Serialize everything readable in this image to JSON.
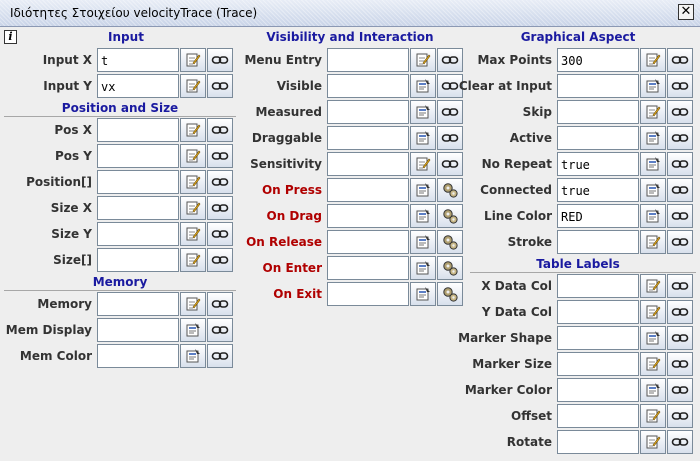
{
  "window": {
    "title": "Ιδιότητες Στοιχείου velocityTrace (Trace)",
    "close_label": "✕",
    "info_label": "i"
  },
  "sections": {
    "input": "Input",
    "position_size": "Position and Size",
    "memory": "Memory",
    "visibility": "Visibility and Interaction",
    "graphical": "Graphical Aspect",
    "table_labels": "Table Labels"
  },
  "col1": {
    "input": [
      {
        "label": "Input X",
        "value": "t",
        "b1": "edit-icon",
        "b2": "link-icon"
      },
      {
        "label": "Input Y",
        "value": "vx",
        "b1": "edit-icon",
        "b2": "link-icon"
      }
    ],
    "position": [
      {
        "label": "Pos X",
        "value": "",
        "b1": "edit-icon",
        "b2": "link-icon"
      },
      {
        "label": "Pos Y",
        "value": "",
        "b1": "edit-icon",
        "b2": "link-icon"
      },
      {
        "label": "Position[]",
        "value": "",
        "b1": "edit-icon",
        "b2": "link-icon"
      },
      {
        "label": "Size X",
        "value": "",
        "b1": "edit-icon",
        "b2": "link-icon"
      },
      {
        "label": "Size Y",
        "value": "",
        "b1": "edit-icon",
        "b2": "link-icon"
      },
      {
        "label": "Size[]",
        "value": "",
        "b1": "edit-icon",
        "b2": "link-icon"
      }
    ],
    "memory": [
      {
        "label": "Memory",
        "value": "",
        "b1": "edit-icon",
        "b2": "link-icon"
      },
      {
        "label": "Mem Display",
        "value": "",
        "b1": "options-icon",
        "b2": "link-icon"
      },
      {
        "label": "Mem Color",
        "value": "",
        "b1": "options-icon",
        "b2": "link-icon"
      }
    ]
  },
  "col2": [
    {
      "label": "Menu Entry",
      "value": "",
      "b1": "edit-icon",
      "b2": "link-icon",
      "red": false
    },
    {
      "label": "Visible",
      "value": "",
      "b1": "options-icon",
      "b2": "link-icon",
      "red": false
    },
    {
      "label": "Measured",
      "value": "",
      "b1": "options-icon",
      "b2": "link-icon",
      "red": false
    },
    {
      "label": "Draggable",
      "value": "",
      "b1": "options-icon",
      "b2": "link-icon",
      "red": false
    },
    {
      "label": "Sensitivity",
      "value": "",
      "b1": "edit-icon",
      "b2": "link-icon",
      "red": false
    },
    {
      "label": "On Press",
      "value": "",
      "b1": "options-icon",
      "b2": "gears-icon",
      "red": true
    },
    {
      "label": "On Drag",
      "value": "",
      "b1": "options-icon",
      "b2": "gears-icon",
      "red": true
    },
    {
      "label": "On Release",
      "value": "",
      "b1": "options-icon",
      "b2": "gears-icon",
      "red": true
    },
    {
      "label": "On Enter",
      "value": "",
      "b1": "options-icon",
      "b2": "gears-icon",
      "red": true
    },
    {
      "label": "On Exit",
      "value": "",
      "b1": "options-icon",
      "b2": "gears-icon",
      "red": true
    }
  ],
  "col3": {
    "graphical": [
      {
        "label": "Max Points",
        "value": "300",
        "b1": "edit-icon",
        "b2": "link-icon"
      },
      {
        "label": "Clear at Input",
        "value": "",
        "b1": "options-icon",
        "b2": "link-icon"
      },
      {
        "label": "Skip",
        "value": "",
        "b1": "edit-icon",
        "b2": "link-icon"
      },
      {
        "label": "Active",
        "value": "",
        "b1": "options-icon",
        "b2": "link-icon"
      },
      {
        "label": "No Repeat",
        "value": "true",
        "b1": "options-icon",
        "b2": "link-icon"
      },
      {
        "label": "Connected",
        "value": "true",
        "b1": "options-icon",
        "b2": "link-icon"
      },
      {
        "label": "Line Color",
        "value": "RED",
        "b1": "options-icon",
        "b2": "link-icon"
      },
      {
        "label": "Stroke",
        "value": "",
        "b1": "edit-icon",
        "b2": "link-icon"
      }
    ],
    "table": [
      {
        "label": "X Data Col",
        "value": "",
        "b1": "edit-icon",
        "b2": "link-icon"
      },
      {
        "label": "Y Data Col",
        "value": "",
        "b1": "edit-icon",
        "b2": "link-icon"
      },
      {
        "label": "Marker Shape",
        "value": "",
        "b1": "options-icon",
        "b2": "link-icon"
      },
      {
        "label": "Marker Size",
        "value": "",
        "b1": "edit-icon",
        "b2": "link-icon"
      },
      {
        "label": "Marker Color",
        "value": "",
        "b1": "options-icon",
        "b2": "link-icon"
      },
      {
        "label": "Offset",
        "value": "",
        "b1": "edit-icon",
        "b2": "link-icon"
      },
      {
        "label": "Rotate",
        "value": "",
        "b1": "edit-icon",
        "b2": "link-icon"
      }
    ]
  }
}
